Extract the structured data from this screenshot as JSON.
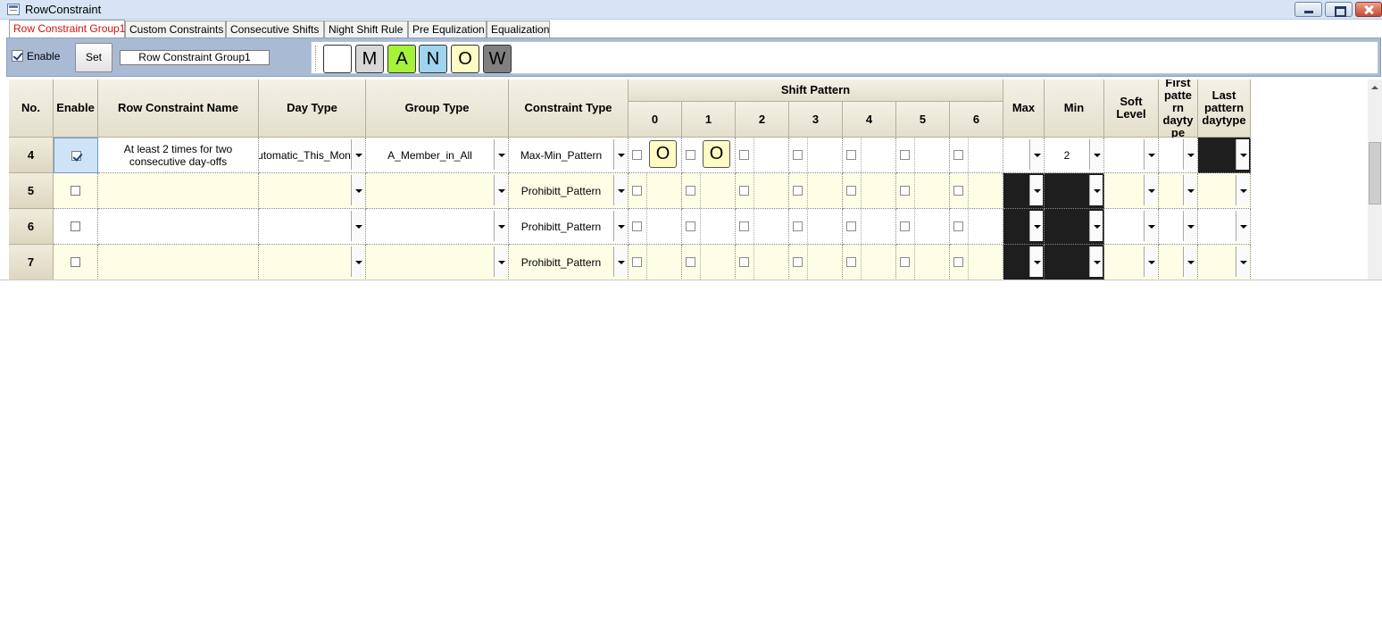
{
  "window": {
    "title": "RowConstraint"
  },
  "tabs": [
    "Row Constraint Group1",
    "Custom Constraints",
    "Consecutive Shifts",
    "Night Shift Rule",
    "Pre Equlization",
    "Equalization"
  ],
  "toolbar": {
    "enable_label": "Enable",
    "enable_checked": true,
    "set_label": "Set",
    "group_name_value": "Row Constraint Group1",
    "palette": [
      {
        "label": "",
        "color": "#ffffff"
      },
      {
        "label": "M",
        "color": "#d8d8d8"
      },
      {
        "label": "A",
        "color": "#a6f23a"
      },
      {
        "label": "N",
        "color": "#9ed4ee"
      },
      {
        "label": "O",
        "color": "#fefbc5"
      },
      {
        "label": "W",
        "color": "#808080"
      }
    ]
  },
  "grid": {
    "headers": {
      "no": "No.",
      "enable": "Enable",
      "name": "Row Constraint Name",
      "day_type": "Day Type",
      "group_type": "Group Type",
      "constraint_type": "Constraint Type",
      "shift_pattern": "Shift Pattern",
      "shift_cols": [
        "0",
        "1",
        "2",
        "3",
        "4",
        "5",
        "6"
      ],
      "max": "Max",
      "min": "Min",
      "soft_level": "Soft Level",
      "first_pattern": "First patte rn dayty pe",
      "last_pattern": "Last pattern daytype"
    },
    "rows": [
      {
        "no": "4",
        "enable": true,
        "name": "At least 2 times for two consecutive day-offs",
        "day_type": "Automatic_This_Month",
        "group_type": "A_Member_in_All",
        "constraint_type": "Max-Min_Pattern",
        "shifts": [
          "O",
          "O",
          "",
          "",
          "",
          "",
          ""
        ],
        "max": "",
        "min": "2",
        "soft_level": "",
        "first": "",
        "last": ""
      },
      {
        "no": "5",
        "enable": false,
        "name": "",
        "day_type": "",
        "group_type": "",
        "constraint_type": "Prohibitt_Pattern",
        "shifts": [
          "",
          "",
          "",
          "",
          "",
          "",
          ""
        ],
        "max": "",
        "min": "",
        "soft_level": "",
        "first": "",
        "last": ""
      },
      {
        "no": "6",
        "enable": false,
        "name": "",
        "day_type": "",
        "group_type": "",
        "constraint_type": "Prohibitt_Pattern",
        "shifts": [
          "",
          "",
          "",
          "",
          "",
          "",
          ""
        ],
        "max": "",
        "min": "",
        "soft_level": "",
        "first": "",
        "last": ""
      },
      {
        "no": "7",
        "enable": false,
        "name": "",
        "day_type": "",
        "group_type": "",
        "constraint_type": "Prohibitt_Pattern",
        "shifts": [
          "",
          "",
          "",
          "",
          "",
          "",
          ""
        ],
        "max": "",
        "min": "",
        "soft_level": "",
        "first": "",
        "last": ""
      }
    ]
  }
}
